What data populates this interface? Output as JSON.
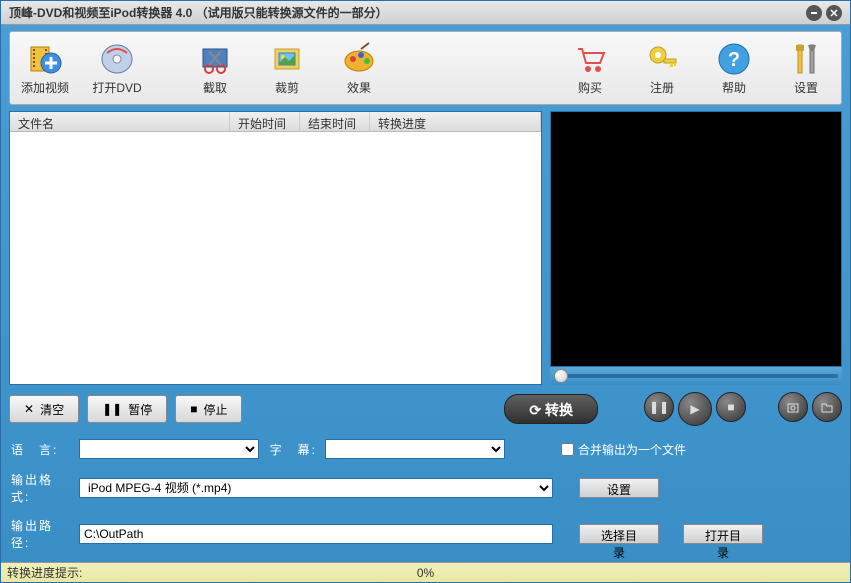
{
  "title": "顶峰-DVD和视频至iPod转换器  4.0 （试用版只能转换源文件的一部分）",
  "toolbar": {
    "left": [
      {
        "label": "添加视频",
        "icon": "add-video"
      },
      {
        "label": "打开DVD",
        "icon": "open-dvd"
      }
    ],
    "mid": [
      {
        "label": "截取",
        "icon": "capture"
      },
      {
        "label": "裁剪",
        "icon": "crop"
      },
      {
        "label": "效果",
        "icon": "effect"
      }
    ],
    "right": [
      {
        "label": "购买",
        "icon": "buy"
      },
      {
        "label": "注册",
        "icon": "register"
      },
      {
        "label": "帮助",
        "icon": "help"
      },
      {
        "label": "设置",
        "icon": "settings"
      }
    ]
  },
  "columns": {
    "name": "文件名",
    "start": "开始时间",
    "end": "结束时间",
    "progress": "转换进度"
  },
  "buttons": {
    "clear": "清空",
    "pause": "暂停",
    "stop": "停止",
    "convert": "转换"
  },
  "form": {
    "lang_label": "语　言:",
    "sub_label": "字　幕:",
    "merge_label": "合并输出为一个文件",
    "format_label": "输出格式:",
    "format_value": "iPod MPEG-4 视频 (*.mp4)",
    "format_settings": "设置",
    "path_label": "输出路径:",
    "path_value": "C:\\OutPath",
    "browse": "选择目录",
    "open_dir": "打开目录"
  },
  "status": {
    "label": "转换进度提示:",
    "percent": "0%"
  }
}
